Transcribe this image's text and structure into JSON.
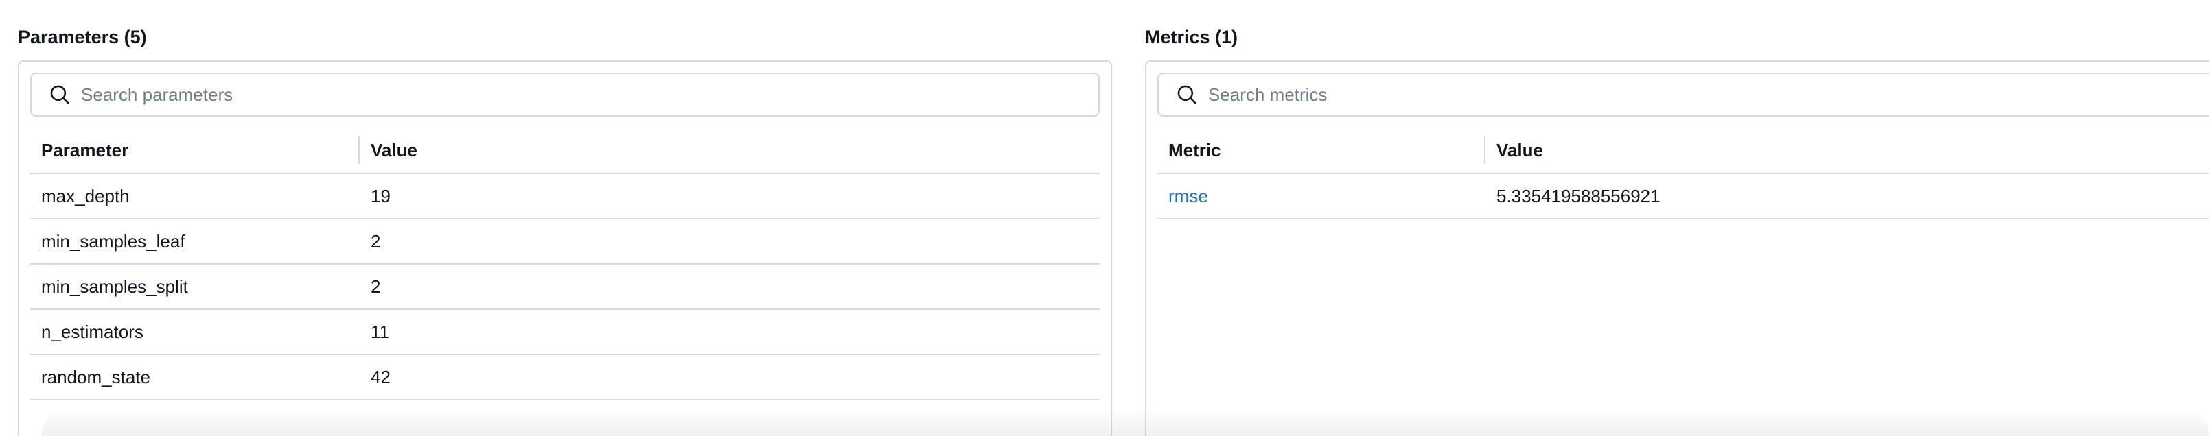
{
  "parameters": {
    "title": "Parameters (5)",
    "search_placeholder": "Search parameters",
    "headers": [
      "Parameter",
      "Value"
    ],
    "rows": [
      {
        "name": "max_depth",
        "value": "19"
      },
      {
        "name": "min_samples_leaf",
        "value": "2"
      },
      {
        "name": "min_samples_split",
        "value": "2"
      },
      {
        "name": "n_estimators",
        "value": "11"
      },
      {
        "name": "random_state",
        "value": "42"
      }
    ]
  },
  "metrics": {
    "title": "Metrics (1)",
    "search_placeholder": "Search metrics",
    "headers": [
      "Metric",
      "Value"
    ],
    "rows": [
      {
        "name": "rmse",
        "value": "5.335419588556921"
      }
    ]
  },
  "colors": {
    "border": "#d1d9e1",
    "link": "#2272b4",
    "placeholder": "#6f7e8c",
    "text": "#11171c"
  },
  "icons": {
    "search": "search-icon"
  }
}
